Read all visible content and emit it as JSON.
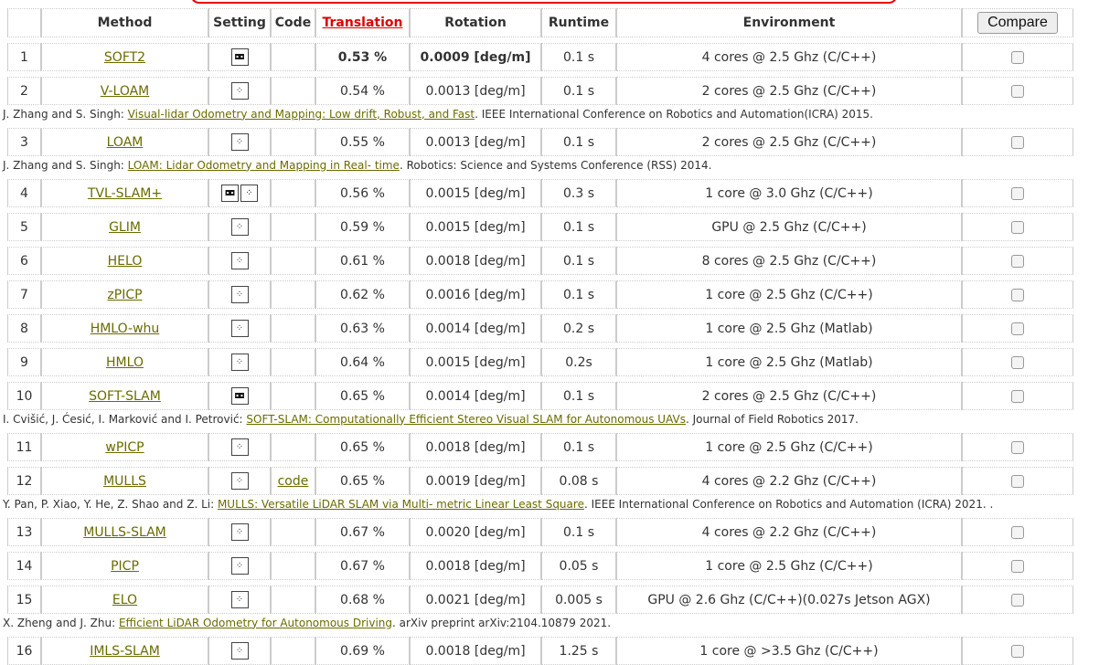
{
  "header": {
    "method": "Method",
    "setting": "Setting",
    "code": "Code",
    "translation": "Translation",
    "rotation": "Rotation",
    "runtime": "Runtime",
    "environment": "Environment",
    "compare_button": "Compare"
  },
  "colors": {
    "link": "#6b6b00",
    "active_sort": "#dd0000"
  },
  "rows": [
    {
      "rank": "1",
      "method": "SOFT2",
      "setting_icons": [
        "stereo-camera-icon"
      ],
      "code": "",
      "translation": "0.53 %",
      "rotation": "0.0009 [deg/m]",
      "runtime": "0.1 s",
      "environment": "4 cores @ 2.5 Ghz (C/C++)",
      "bold": true
    },
    {
      "rank": "2",
      "method": "V-LOAM",
      "setting_icons": [
        "laser-points-icon"
      ],
      "code": "",
      "translation": "0.54 %",
      "rotation": "0.0013 [deg/m]",
      "runtime": "0.1 s",
      "environment": "2 cores @ 2.5 Ghz (C/C++)",
      "ref": {
        "authors": "J. Zhang and S. Singh: ",
        "title": "Visual-lidar Odometry and Mapping: Low drift, Robust, and Fast",
        "venue": ". IEEE International Conference on Robotics and Automation(ICRA) 2015."
      }
    },
    {
      "rank": "3",
      "method": "LOAM",
      "setting_icons": [
        "laser-points-icon"
      ],
      "code": "",
      "translation": "0.55 %",
      "rotation": "0.0013 [deg/m]",
      "runtime": "0.1 s",
      "environment": "2 cores @ 2.5 Ghz (C/C++)",
      "ref": {
        "authors": "J. Zhang and S. Singh: ",
        "title": "LOAM: Lidar Odometry and Mapping in Real- time",
        "venue": ". Robotics: Science and Systems Conference (RSS) 2014."
      }
    },
    {
      "rank": "4",
      "method": "TVL-SLAM+",
      "setting_icons": [
        "stereo-camera-icon",
        "laser-points-icon"
      ],
      "code": "",
      "translation": "0.56 %",
      "rotation": "0.0015 [deg/m]",
      "runtime": "0.3 s",
      "environment": "1 core @ 3.0 Ghz (C/C++)"
    },
    {
      "rank": "5",
      "method": "GLIM",
      "setting_icons": [
        "laser-points-icon"
      ],
      "code": "",
      "translation": "0.59 %",
      "rotation": "0.0015 [deg/m]",
      "runtime": "0.1 s",
      "environment": "GPU @ 2.5 Ghz (C/C++)"
    },
    {
      "rank": "6",
      "method": "HELO",
      "setting_icons": [
        "laser-points-icon"
      ],
      "code": "",
      "translation": "0.61 %",
      "rotation": "0.0018 [deg/m]",
      "runtime": "0.1 s",
      "environment": "8 cores @ 2.5 Ghz (C/C++)"
    },
    {
      "rank": "7",
      "method": "zPICP",
      "setting_icons": [
        "laser-points-icon"
      ],
      "code": "",
      "translation": "0.62 %",
      "rotation": "0.0016 [deg/m]",
      "runtime": "0.1 s",
      "environment": "1 core @ 2.5 Ghz (C/C++)"
    },
    {
      "rank": "8",
      "method": "HMLO-whu",
      "setting_icons": [
        "laser-points-icon"
      ],
      "code": "",
      "translation": "0.63 %",
      "rotation": "0.0014 [deg/m]",
      "runtime": "0.2 s",
      "environment": "1 core @ 2.5 Ghz (Matlab)"
    },
    {
      "rank": "9",
      "method": "HMLO",
      "setting_icons": [
        "laser-points-icon"
      ],
      "code": "",
      "translation": "0.64 %",
      "rotation": "0.0015 [deg/m]",
      "runtime": "0.2s",
      "environment": "1 core @ 2.5 Ghz (Matlab)"
    },
    {
      "rank": "10",
      "method": "SOFT-SLAM",
      "setting_icons": [
        "stereo-camera-icon"
      ],
      "code": "",
      "translation": "0.65 %",
      "rotation": "0.0014 [deg/m]",
      "runtime": "0.1 s",
      "environment": "2 cores @ 2.5 Ghz (C/C++)",
      "ref": {
        "authors": "I. Cvišić, J. Ćesić, I. Marković and I. Petrović: ",
        "title": "SOFT-SLAM: Computationally Efficient Stereo Visual SLAM for Autonomous UAVs",
        "venue": ". Journal of Field Robotics 2017."
      }
    },
    {
      "rank": "11",
      "method": "wPICP",
      "setting_icons": [
        "laser-points-icon"
      ],
      "code": "",
      "translation": "0.65 %",
      "rotation": "0.0018 [deg/m]",
      "runtime": "0.1 s",
      "environment": "1 core @ 2.5 Ghz (C/C++)"
    },
    {
      "rank": "12",
      "method": "MULLS",
      "setting_icons": [
        "laser-points-icon"
      ],
      "code": "code",
      "translation": "0.65 %",
      "rotation": "0.0019 [deg/m]",
      "runtime": "0.08 s",
      "environment": "4 cores @ 2.2 Ghz (C/C++)",
      "ref": {
        "authors": "Y. Pan, P. Xiao, Y. He, Z. Shao and Z. Li: ",
        "title": "MULLS: Versatile LiDAR SLAM via Multi- metric Linear Least Square",
        "venue": ". IEEE International Conference on Robotics and Automation (ICRA) 2021. ."
      }
    },
    {
      "rank": "13",
      "method": "MULLS-SLAM",
      "setting_icons": [
        "laser-points-icon"
      ],
      "code": "",
      "translation": "0.67 %",
      "rotation": "0.0020 [deg/m]",
      "runtime": "0.1 s",
      "environment": "4 cores @ 2.2 Ghz (C/C++)"
    },
    {
      "rank": "14",
      "method": "PICP",
      "setting_icons": [
        "laser-points-icon"
      ],
      "code": "",
      "translation": "0.67 %",
      "rotation": "0.0018 [deg/m]",
      "runtime": "0.05 s",
      "environment": "1 core @ 2.5 Ghz (C/C++)"
    },
    {
      "rank": "15",
      "method": "ELO",
      "setting_icons": [
        "laser-points-icon"
      ],
      "code": "",
      "translation": "0.68 %",
      "rotation": "0.0021 [deg/m]",
      "runtime": "0.005 s",
      "environment": "GPU @ 2.6 Ghz (C/C++)(0.027s Jetson AGX)",
      "ref": {
        "authors": "X. Zheng and J. Zhu: ",
        "title": "Efficient LiDAR Odometry for Autonomous Driving",
        "venue": ". arXiv preprint arXiv:2104.10879 2021."
      }
    },
    {
      "rank": "16",
      "method": "IMLS-SLAM",
      "setting_icons": [
        "laser-points-icon"
      ],
      "code": "",
      "translation": "0.69 %",
      "rotation": "0.0018 [deg/m]",
      "runtime": "1.25 s",
      "environment": "1 core @ >3.5 Ghz (C/C++)"
    }
  ]
}
